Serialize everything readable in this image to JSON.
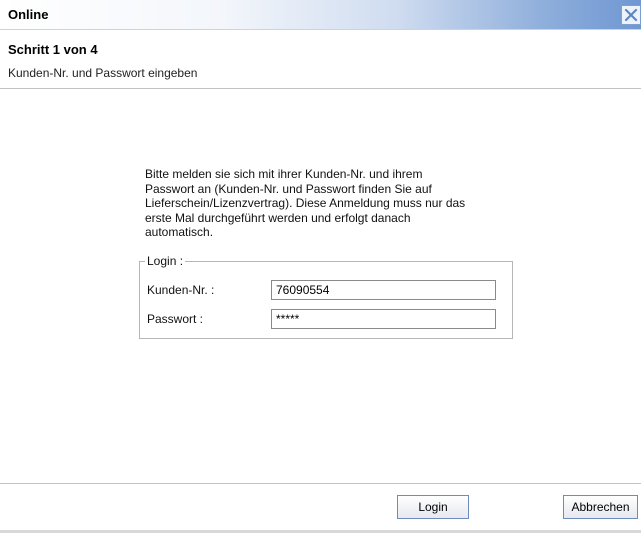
{
  "window": {
    "title": "Online",
    "close_icon": "close-icon"
  },
  "header": {
    "step_title": "Schritt 1 von 4",
    "step_subtitle": "Kunden-Nr. und Passwort eingeben"
  },
  "content": {
    "intro_lines": [
      "Bitte melden sie sich mit ihrer Kunden-Nr. und ihrem",
      "Passwort an (Kunden-Nr. und Passwort finden Sie auf",
      "Lieferschein/Lizenzvertrag). Diese Anmeldung muss nur das",
      "erste Mal durchgeführt werden und erfolgt danach",
      "automatisch."
    ],
    "login_group": {
      "legend": "Login :",
      "customer_label": "Kunden-Nr. :",
      "customer_value": "76090554",
      "password_label": "Passwort :",
      "password_value": "*****"
    }
  },
  "footer": {
    "login_label": "Login",
    "cancel_label": "Abbrechen"
  },
  "colors": {
    "titlebar_gradient_end": "#6f97d3",
    "button_border": "#6d8bbd"
  }
}
